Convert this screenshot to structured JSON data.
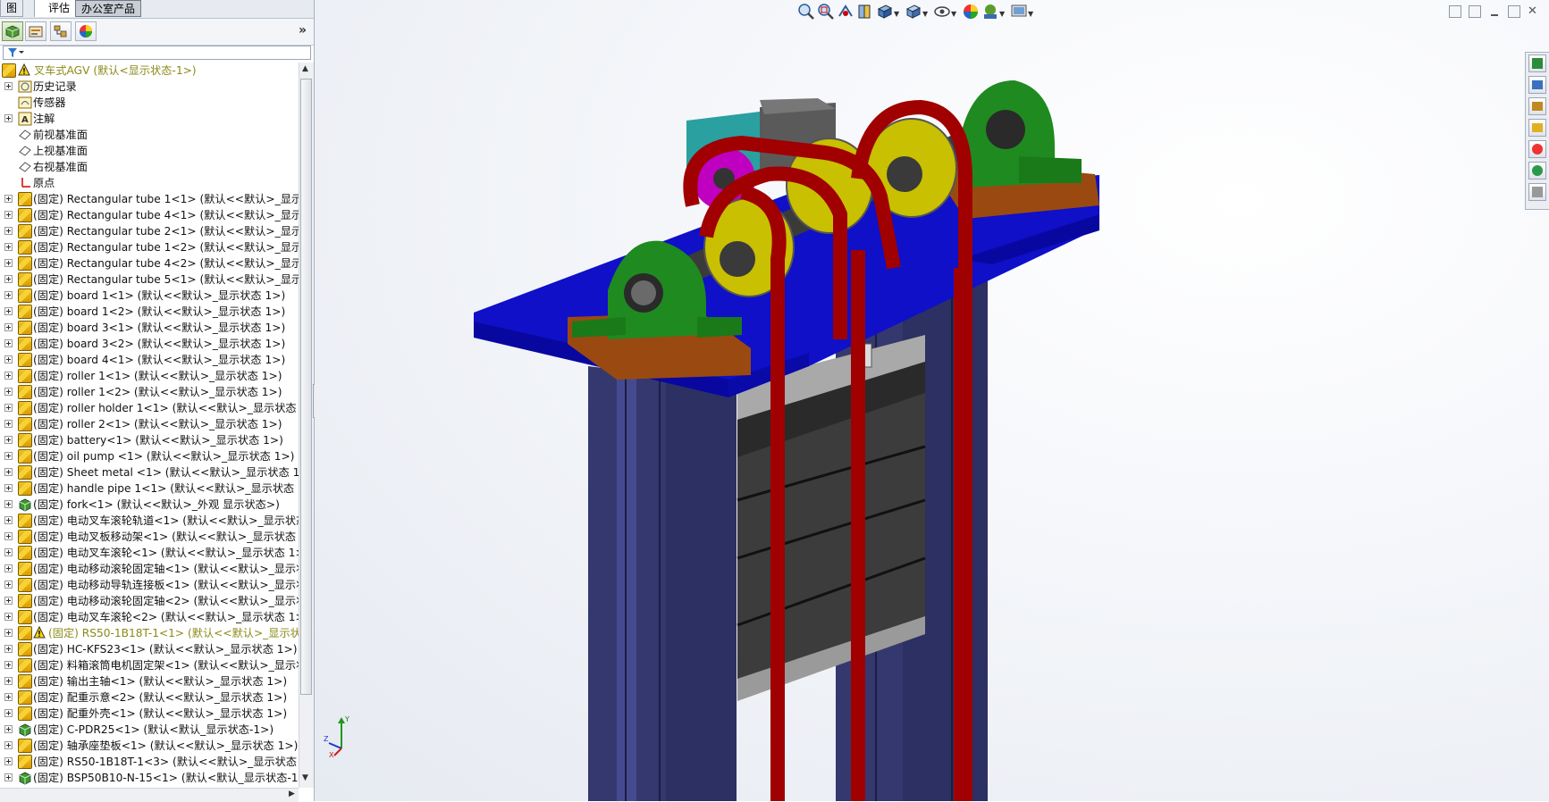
{
  "tabs": [
    {
      "label": "图",
      "state": "normal"
    },
    {
      "label": "评估",
      "state": "active"
    },
    {
      "label": "办公室产品",
      "state": "pressed"
    }
  ],
  "feature_manager_tools": [
    {
      "name": "featuremanager-tree-icon",
      "selected": true
    },
    {
      "name": "propertymanager-icon",
      "selected": false
    },
    {
      "name": "configurationmanager-icon",
      "selected": false
    },
    {
      "name": "displaymanager-icon",
      "selected": false
    }
  ],
  "expand_glyph": "»",
  "tree": {
    "root": "叉车式AGV  (默认<显示状态-1>)",
    "items": [
      {
        "label": "历史记录",
        "icon": "history-icon",
        "expand": true
      },
      {
        "label": "传感器",
        "icon": "sensor-icon",
        "expand": false
      },
      {
        "label": "注解",
        "icon": "annotation-icon",
        "expand": true
      },
      {
        "label": "前视基准面",
        "icon": "plane-icon",
        "expand": false
      },
      {
        "label": "上视基准面",
        "icon": "plane-icon",
        "expand": false
      },
      {
        "label": "右视基准面",
        "icon": "plane-icon",
        "expand": false
      },
      {
        "label": "原点",
        "icon": "origin-icon",
        "expand": false
      },
      {
        "label": "(固定) Rectangular tube 1<1> (默认<<默认>_显示状",
        "icon": "part-icon",
        "expand": true
      },
      {
        "label": "(固定) Rectangular tube 4<1> (默认<<默认>_显示状",
        "icon": "part-icon",
        "expand": true
      },
      {
        "label": "(固定) Rectangular tube 2<1> (默认<<默认>_显示状",
        "icon": "part-icon",
        "expand": true
      },
      {
        "label": "(固定) Rectangular tube 1<2> (默认<<默认>_显示状",
        "icon": "part-icon",
        "expand": true
      },
      {
        "label": "(固定) Rectangular tube 4<2> (默认<<默认>_显示状",
        "icon": "part-icon",
        "expand": true
      },
      {
        "label": "(固定) Rectangular tube 5<1> (默认<<默认>_显示状",
        "icon": "part-icon",
        "expand": true
      },
      {
        "label": "(固定) board 1<1> (默认<<默认>_显示状态 1>)",
        "icon": "part-icon",
        "expand": true
      },
      {
        "label": "(固定) board 1<2> (默认<<默认>_显示状态 1>)",
        "icon": "part-icon",
        "expand": true
      },
      {
        "label": "(固定) board 3<1> (默认<<默认>_显示状态 1>)",
        "icon": "part-icon",
        "expand": true
      },
      {
        "label": "(固定) board 3<2> (默认<<默认>_显示状态 1>)",
        "icon": "part-icon",
        "expand": true
      },
      {
        "label": "(固定) board 4<1> (默认<<默认>_显示状态 1>)",
        "icon": "part-icon",
        "expand": true
      },
      {
        "label": "(固定) roller 1<1> (默认<<默认>_显示状态 1>)",
        "icon": "part-icon",
        "expand": true
      },
      {
        "label": "(固定) roller 1<2> (默认<<默认>_显示状态 1>)",
        "icon": "part-icon",
        "expand": true
      },
      {
        "label": "(固定) roller holder 1<1> (默认<<默认>_显示状态 1",
        "icon": "part-icon",
        "expand": true
      },
      {
        "label": "(固定) roller 2<1> (默认<<默认>_显示状态 1>)",
        "icon": "part-icon",
        "expand": true
      },
      {
        "label": "(固定) battery<1> (默认<<默认>_显示状态 1>)",
        "icon": "part-icon",
        "expand": true
      },
      {
        "label": "(固定) oil pump <1> (默认<<默认>_显示状态 1>)",
        "icon": "part-icon",
        "expand": true
      },
      {
        "label": "(固定) Sheet metal <1> (默认<<默认>_显示状态 1>)",
        "icon": "part-icon",
        "expand": true
      },
      {
        "label": "(固定) handle pipe 1<1> (默认<<默认>_显示状态 1>",
        "icon": "part-icon",
        "expand": true
      },
      {
        "label": "(固定) fork<1> (默认<<默认>_外观 显示状态>)",
        "icon": "assembly-icon",
        "expand": true
      },
      {
        "label": "(固定) 电动叉车滚轮轨道<1> (默认<<默认>_显示状态",
        "icon": "part-icon",
        "expand": true
      },
      {
        "label": "(固定) 电动叉板移动架<1> (默认<<默认>_显示状态 1",
        "icon": "part-icon",
        "expand": true
      },
      {
        "label": "(固定) 电动叉车滚轮<1> (默认<<默认>_显示状态 1>)",
        "icon": "part-icon",
        "expand": true
      },
      {
        "label": "(固定) 电动移动滚轮固定轴<1> (默认<<默认>_显示状",
        "icon": "part-icon",
        "expand": true
      },
      {
        "label": "(固定) 电动移动导轨连接板<1> (默认<<默认>_显示状",
        "icon": "part-icon",
        "expand": true
      },
      {
        "label": "(固定) 电动移动滚轮固定轴<2> (默认<<默认>_显示状",
        "icon": "part-icon",
        "expand": true
      },
      {
        "label": "(固定) 电动叉车滚轮<2> (默认<<默认>_显示状态 1>)",
        "icon": "part-icon",
        "expand": true
      },
      {
        "label": "(固定) RS50-1B18T-1<1> (默认<<默认>_显示状态",
        "icon": "part-icon",
        "expand": true,
        "warning": true
      },
      {
        "label": "(固定) HC-KFS23<1> (默认<<默认>_显示状态 1>)",
        "icon": "part-icon",
        "expand": true
      },
      {
        "label": "(固定) 料箱滚筒电机固定架<1> (默认<<默认>_显示状",
        "icon": "part-icon",
        "expand": true
      },
      {
        "label": "(固定) 输出主轴<1> (默认<<默认>_显示状态 1>)",
        "icon": "part-icon",
        "expand": true
      },
      {
        "label": "(固定) 配重示意<2> (默认<<默认>_显示状态 1>)",
        "icon": "part-icon",
        "expand": true
      },
      {
        "label": "(固定) 配重外壳<1> (默认<<默认>_显示状态 1>)",
        "icon": "part-icon",
        "expand": true
      },
      {
        "label": "(固定) C-PDR25<1> (默认<默认_显示状态-1>)",
        "icon": "assembly-icon",
        "expand": true
      },
      {
        "label": "(固定) 轴承座垫板<1> (默认<<默认>_显示状态 1>)",
        "icon": "part-icon",
        "expand": true
      },
      {
        "label": "(固定) RS50-1B18T-1<3> (默认<<默认>_显示状态 1:",
        "icon": "part-icon",
        "expand": true
      },
      {
        "label": "(固定) BSP50B10-N-15<1> (默认<默认_显示状态-1>",
        "icon": "assembly-icon",
        "expand": true
      }
    ]
  },
  "hud_tools": [
    "zoom-to-fit-icon",
    "zoom-area-icon",
    "previous-view-icon",
    "section-view-icon",
    "view-orientation-icon",
    "display-style-icon",
    "hide-show-icon",
    "edit-appearance-icon",
    "apply-scene-icon",
    "view-settings-icon"
  ],
  "task_pane": [
    "solidworks-resources-icon",
    "design-library-icon",
    "file-explorer-icon",
    "view-palette-icon",
    "appearances-icon",
    "custom-properties-icon",
    "document-recovery-icon"
  ],
  "triad": {
    "x": "X",
    "y": "Y",
    "z": "Z"
  },
  "colors": {
    "column": "#3a3f8a",
    "platform": "#1010c8",
    "bearing": "#1f8a1f",
    "chain": "#a00000",
    "sprocket": "#c8c000",
    "pad": "#9a4a10",
    "box": "#555555",
    "motor": "#2aa0a0"
  }
}
